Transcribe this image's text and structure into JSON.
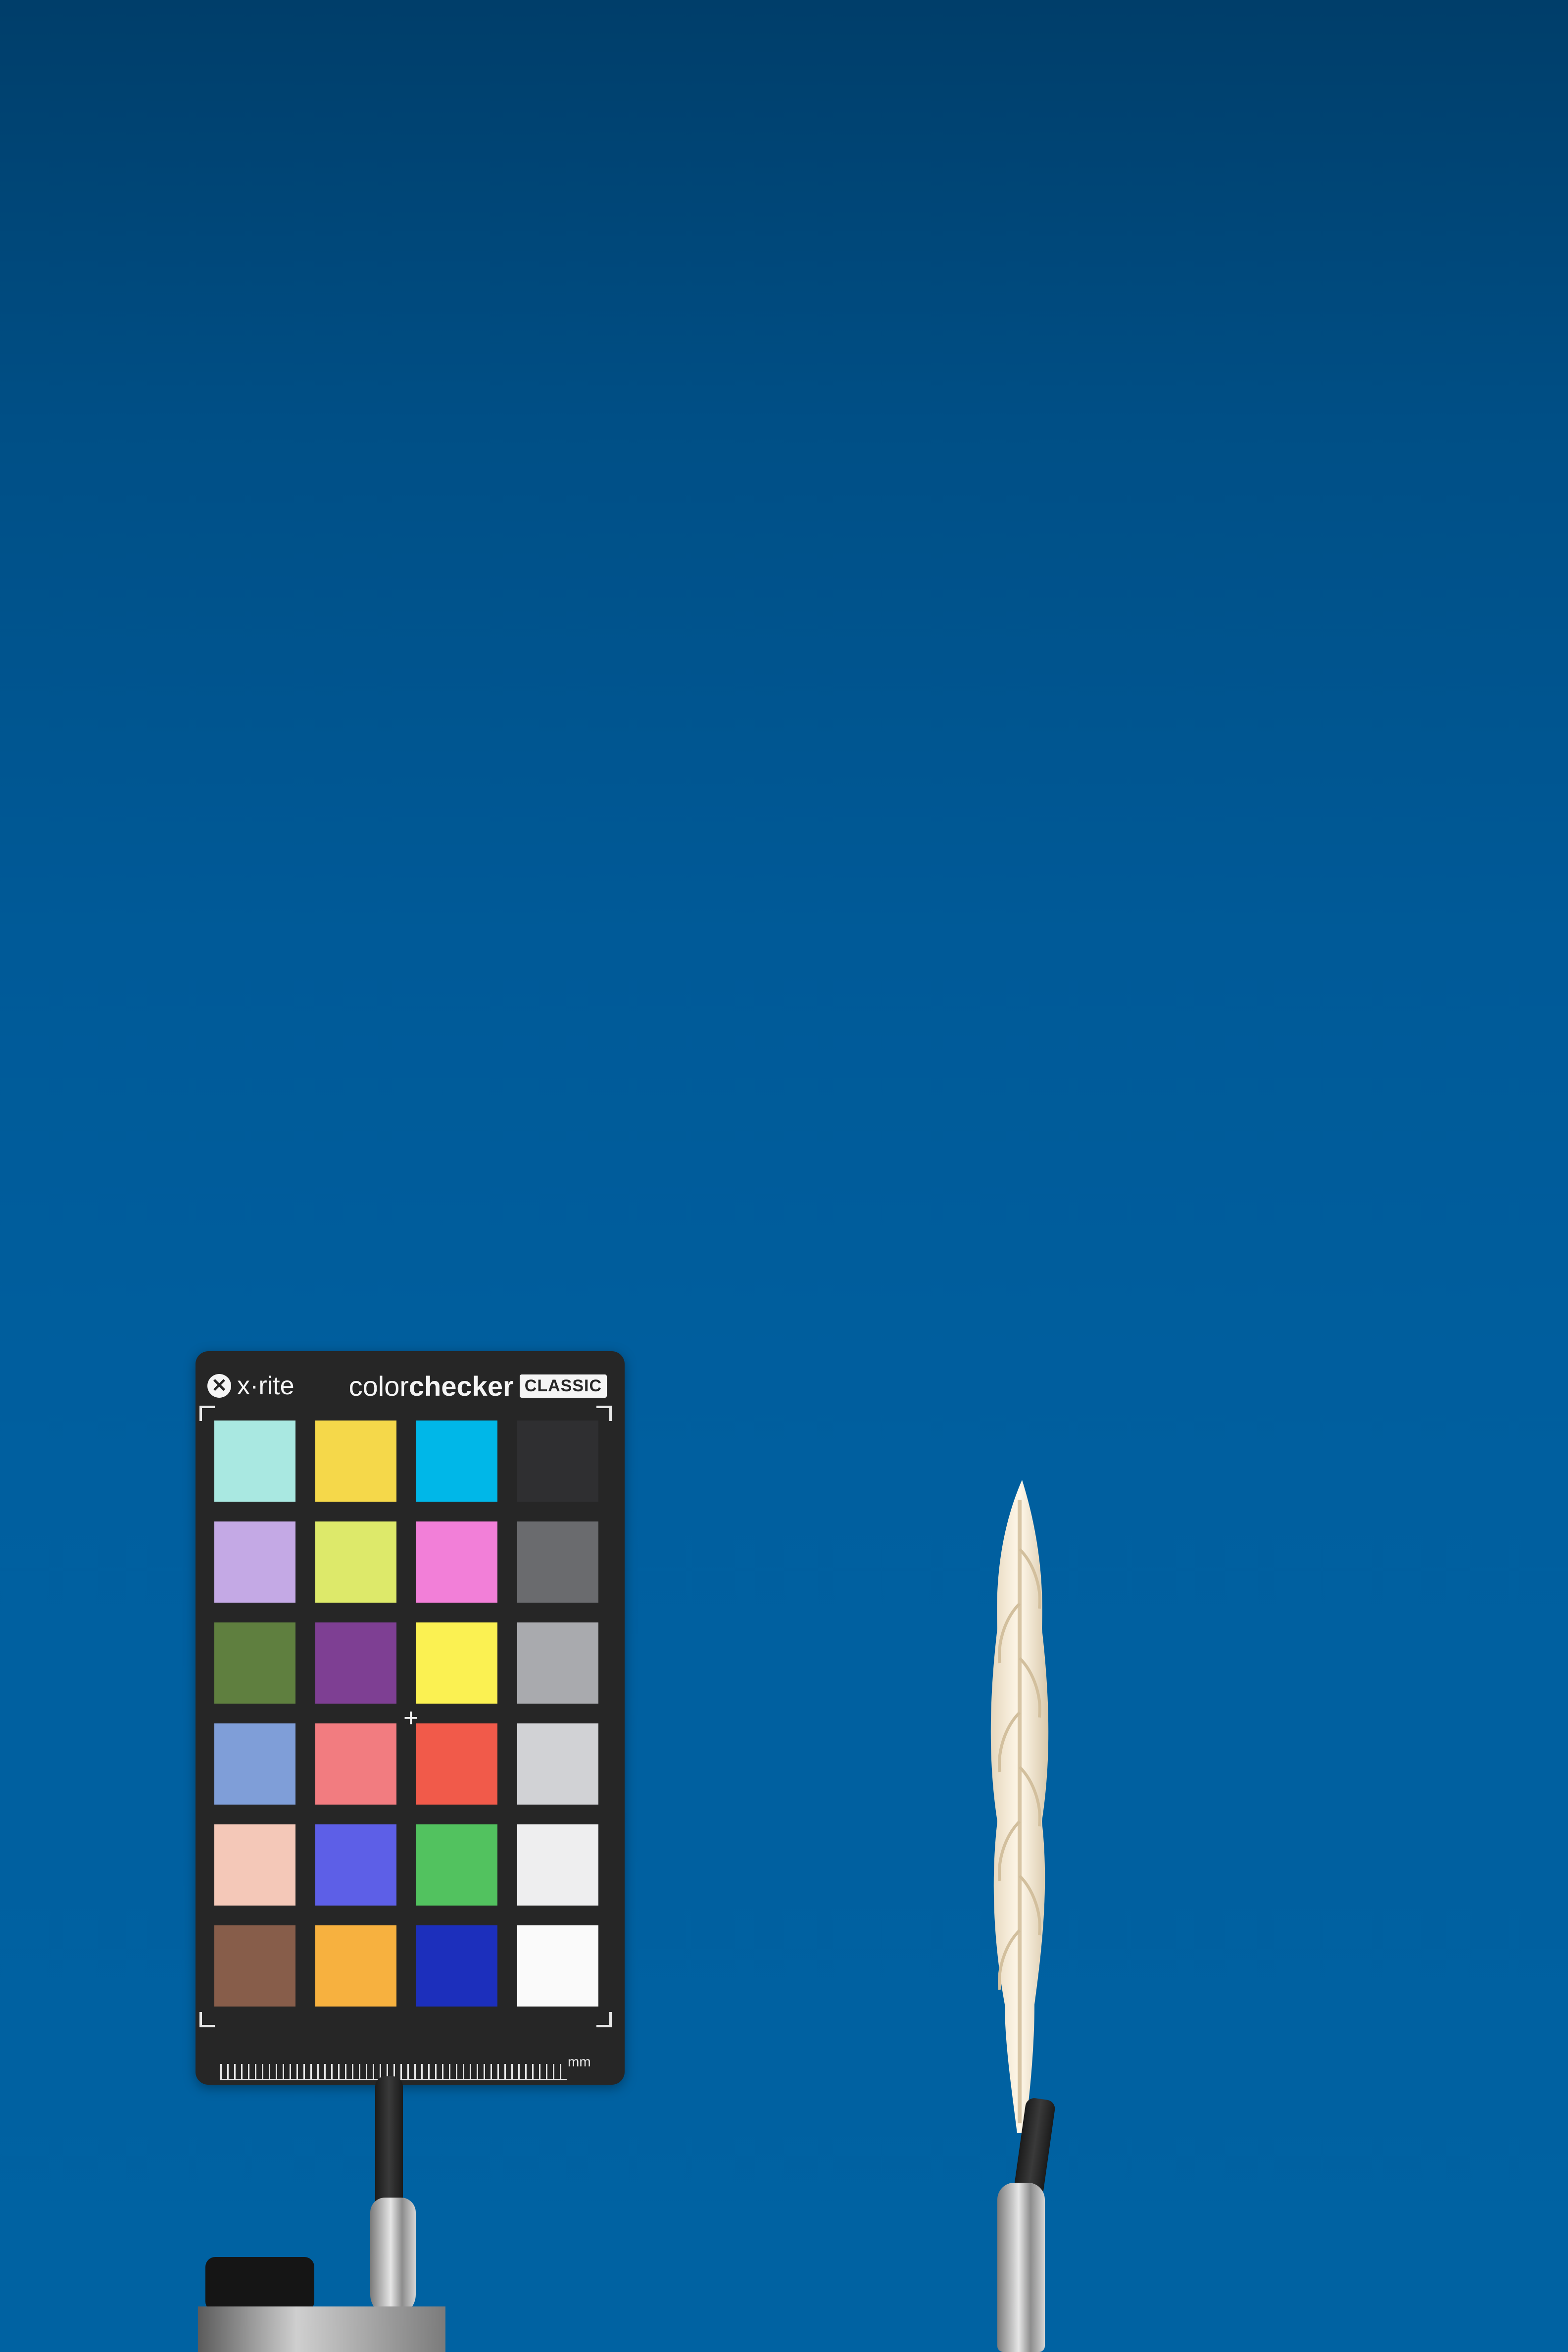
{
  "scene": {
    "background_color": "#005a98",
    "description_items": [
      "color-checker-card",
      "wheat-spike",
      "clips"
    ]
  },
  "checker": {
    "brand": "x·rite",
    "brand_logo": "✕",
    "product_light": "color",
    "product_bold": "checker",
    "badge": "CLASSIC",
    "ruler_unit": "mm",
    "crosshair": "+",
    "patches": [
      "#a9e8e1",
      "#f5d84a",
      "#00b7e8",
      "#2f2f31",
      "#c4a9e5",
      "#dde96a",
      "#f27fd8",
      "#6a6b6e",
      "#5f7f3f",
      "#7e3f93",
      "#fbf152",
      "#a9aaae",
      "#7f9ed8",
      "#f27c80",
      "#f15a4a",
      "#d1d2d5",
      "#f4c8b8",
      "#5d5fe7",
      "#52c25f",
      "#eeeeef",
      "#875d4a",
      "#f7b13f",
      "#1c2fbc",
      "#fafafa"
    ]
  }
}
